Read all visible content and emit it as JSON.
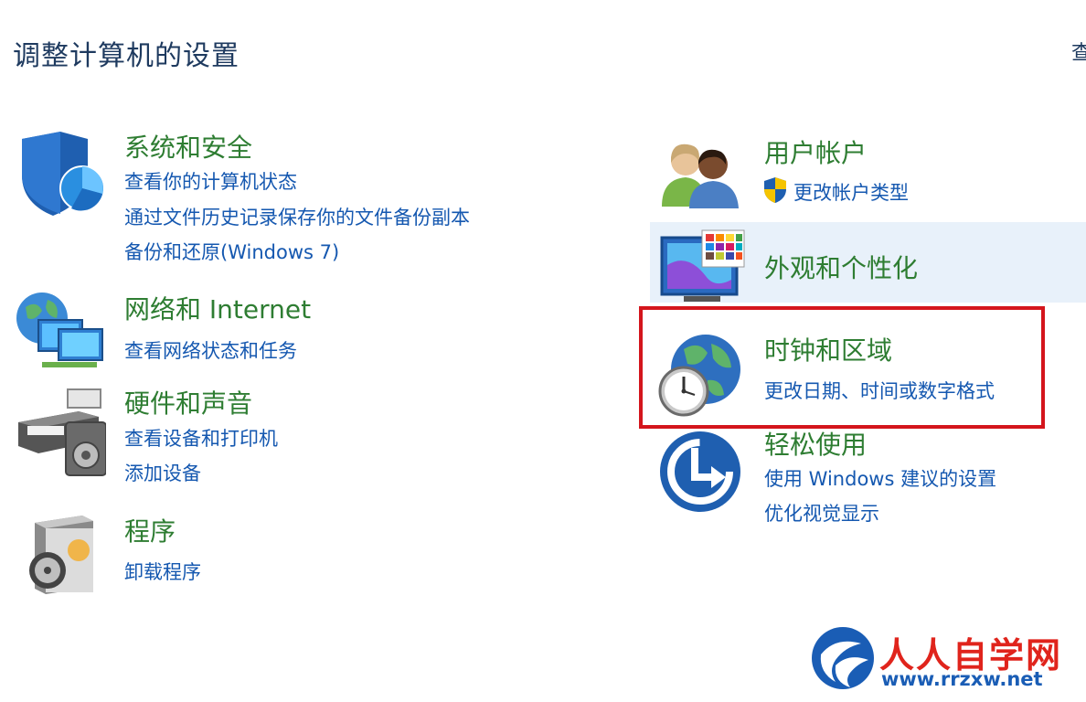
{
  "page_title": "调整计算机的设置",
  "view_by": "查",
  "categories": {
    "system": {
      "title": "系统和安全",
      "links": [
        "查看你的计算机状态",
        "通过文件历史记录保存你的文件备份副本",
        "备份和还原(Windows 7)"
      ]
    },
    "network": {
      "title": "网络和 Internet",
      "links": [
        "查看网络状态和任务"
      ]
    },
    "hardware": {
      "title": "硬件和声音",
      "links": [
        "查看设备和打印机",
        "添加设备"
      ]
    },
    "programs": {
      "title": "程序",
      "links": [
        "卸载程序"
      ]
    },
    "users": {
      "title": "用户帐户",
      "links": [
        "更改帐户类型"
      ]
    },
    "appearance": {
      "title": "外观和个性化"
    },
    "clock": {
      "title": "时钟和区域",
      "links": [
        "更改日期、时间或数字格式"
      ]
    },
    "ease": {
      "title": "轻松使用",
      "links": [
        "使用 Windows 建议的设置",
        "优化视觉显示"
      ]
    }
  },
  "watermark": {
    "name": "人人自学网",
    "url": "www.rrzxw.net"
  },
  "colors": {
    "title_green": "#2e7d32",
    "link_blue": "#1558b0",
    "highlight_red": "#d4151c",
    "hover_bg": "#e8f1fa"
  }
}
